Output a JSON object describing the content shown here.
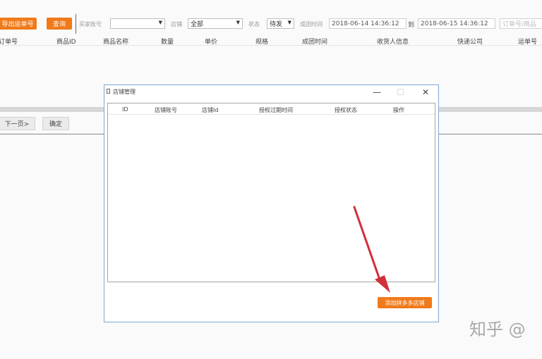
{
  "toolbar": {
    "import_button": "导出运单号",
    "query_button": "查询",
    "buyer_account_label": "买家账号",
    "buyer_account_value": "",
    "store_label": "店铺",
    "store_value": "全部",
    "status_label": "状态",
    "status_value": "待发",
    "pay_time_label": "成团时间",
    "date_from": "2018-06-14 14:36:12",
    "to_label": "到",
    "date_to": "2018-06-15 14:36:12",
    "extra_field_placeholder": "订单号/商品"
  },
  "table": {
    "columns": [
      "订单号",
      "商品ID",
      "商品名称",
      "数量",
      "单价",
      "规格",
      "成团时间",
      "收货人信息",
      "快递公司",
      "运单号"
    ]
  },
  "pager": {
    "next_button": "下一页>",
    "confirm_button": "确定"
  },
  "dialog": {
    "title": "店铺管理",
    "columns": [
      "ID",
      "店铺账号",
      "店铺Id",
      "授权过期时间",
      "授权状态",
      "操作"
    ],
    "add_button": "添加拼多多店铺"
  },
  "watermark": {
    "text": "知乎 @"
  },
  "colors": {
    "accent": "#f07a1a",
    "annotation_arrow": "#d0303a"
  }
}
